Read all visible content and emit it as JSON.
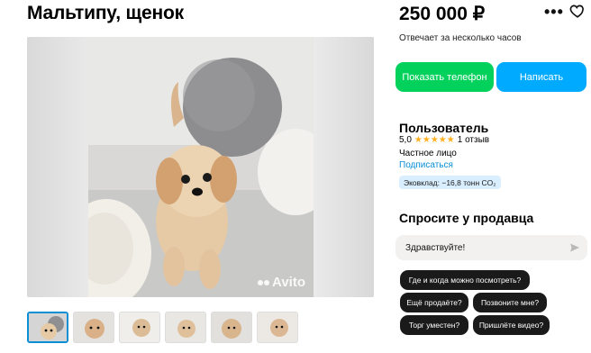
{
  "title": "Мальтипу, щенок",
  "price": "250 000 ₽",
  "reply_time": "Отвечает за несколько часов",
  "buttons": {
    "show_phone": "Показать телефон",
    "write": "Написать"
  },
  "menu": {
    "more": "•••"
  },
  "seller": {
    "name": "Пользователь",
    "rating": "5,0",
    "stars": "★★★★★",
    "reviews": "1 отзыв",
    "type": "Частное лицо",
    "subscribe": "Подписаться",
    "eco": "Эковклад: −16,8 тонн CO₂"
  },
  "ask": {
    "title": "Спросите у продавца",
    "message": "Здравствуйте!",
    "chips": [
      "Где и когда можно посмотреть?",
      "Ещё продаёте?",
      "Позвоните мне?",
      "Торг уместен?",
      "Пришлёте видео?"
    ]
  },
  "watermark": "Avito",
  "thumbnails_count": 6,
  "colors": {
    "green": "#02d15c",
    "blue": "#00aaff",
    "link": "#0a8ed6",
    "stars": "#ffb021"
  }
}
